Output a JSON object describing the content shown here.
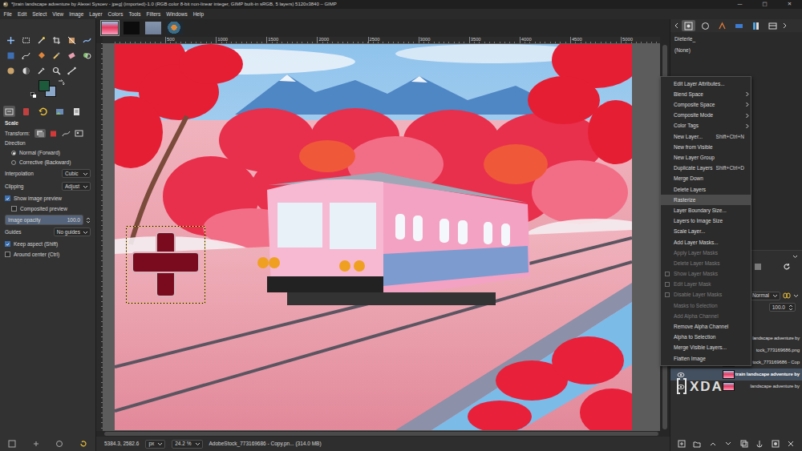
{
  "window": {
    "title": "*[train landscape adventure by Alexei Sysoev - jpeg] (imported)-1.0 (RGB color 8-bit non-linear integer, GIMP built-in sRGB, 5 layers) 5120x3840 – GIMP",
    "controls": [
      "—",
      "□",
      "✕"
    ]
  },
  "menubar": [
    "File",
    "Edit",
    "Select",
    "View",
    "Image",
    "Layer",
    "Colors",
    "Tools",
    "Filters",
    "Windows",
    "Help"
  ],
  "image_tabs": [
    {
      "selected": true
    },
    {
      "selected": false
    },
    {
      "selected": false
    },
    {
      "selected": false
    }
  ],
  "colors": [
    {
      "kind": "foreground",
      "color": "#1d5a3c"
    },
    {
      "kind": "background",
      "color": "#8aa6c8"
    }
  ],
  "tool_options": {
    "tabs": [
      {
        "selected": true
      },
      {
        "selected": false
      },
      {
        "selected": false
      },
      {
        "selected": false
      },
      {
        "selected": false
      }
    ],
    "title": "Scale",
    "transform": {
      "label": "Transform:",
      "options": [
        {
          "selected": true
        },
        {
          "selected": false
        },
        {
          "selected": false
        },
        {
          "selected": false
        }
      ]
    },
    "direction": {
      "label": "Direction",
      "options": [
        {
          "label": "Normal (Forward)",
          "selected": true
        },
        {
          "label": "Corrective (Backward)",
          "selected": false
        }
      ]
    },
    "rows": [
      {
        "kind": "dropdown",
        "label": "Interpolation",
        "value": "Cubic"
      },
      {
        "kind": "dropdown",
        "label": "Clipping",
        "value": "Adjust"
      },
      {
        "kind": "check",
        "label": "Show image preview",
        "checked": true
      },
      {
        "kind": "subcheck",
        "label": "Composited preview",
        "checked": false
      },
      {
        "kind": "slider",
        "label": "Image opacity",
        "value": "100.0",
        "level": 1
      },
      {
        "kind": "dropdown",
        "label": "Guides",
        "value": "No guides"
      },
      {
        "kind": "check",
        "label": "Keep aspect (Shift)",
        "checked": true
      },
      {
        "kind": "check",
        "label": "Around center (Ctrl)",
        "checked": false
      }
    ]
  },
  "ruler": {
    "ticks": [
      "500",
      "1000",
      "1500",
      "2000",
      "2500",
      "3000",
      "3500",
      "4000",
      "4500",
      "5000"
    ]
  },
  "status_bar": {
    "coords": "5384.3, 2582.6",
    "unit": "px",
    "zoom": "24.2 %",
    "info": "AdobeStock_773169686 - Copy.pn... (314.0 MB)"
  },
  "dock": {
    "tabs": [
      {
        "selected": true
      },
      {
        "selected": false
      },
      {
        "selected": false
      },
      {
        "selected": false
      },
      {
        "selected": false
      },
      {
        "selected": false
      }
    ],
    "brush": "Dieterle_",
    "pattern": "(None)",
    "layers": {
      "mode": "Normal",
      "opacity": "100.0",
      "items": [
        {
          "name": "landscape adventure by",
          "visible": true,
          "selected": false
        },
        {
          "name": "tock_773169686.png",
          "visible": true,
          "selected": false
        },
        {
          "name": "tock_773169686 - Cop",
          "visible": true,
          "selected": false
        },
        {
          "name": "train landscape adventure by",
          "visible": true,
          "selected": true
        },
        {
          "name": "landscape adventure by",
          "visible": true,
          "selected": false
        }
      ]
    }
  },
  "context_menu": {
    "items": [
      {
        "label": "Edit Layer Attributes...",
        "kind": "command",
        "disabled": false,
        "selected": false
      },
      {
        "label": "Blend Space",
        "kind": "submenu",
        "disabled": false,
        "selected": false
      },
      {
        "label": "Composite Space",
        "kind": "submenu",
        "disabled": false,
        "selected": false
      },
      {
        "label": "Composite Mode",
        "kind": "submenu",
        "disabled": false,
        "selected": false
      },
      {
        "label": "Color Tags",
        "kind": "submenu",
        "disabled": false,
        "selected": false
      },
      {
        "label": "New Layer...",
        "kind": "command",
        "shortcut": "Shift+Ctrl+N",
        "disabled": false,
        "selected": false
      },
      {
        "label": "New from Visible",
        "kind": "command",
        "disabled": false,
        "selected": false
      },
      {
        "label": "New Layer Group",
        "kind": "command",
        "disabled": false,
        "selected": false
      },
      {
        "label": "Duplicate Layers",
        "kind": "command",
        "shortcut": "Shift+Ctrl+D",
        "disabled": false,
        "selected": false
      },
      {
        "label": "Merge Down",
        "kind": "command",
        "disabled": false,
        "selected": false
      },
      {
        "label": "Delete Layers",
        "kind": "command",
        "disabled": false,
        "selected": false
      },
      {
        "label": "Rasterize",
        "kind": "command",
        "disabled": false,
        "selected": true
      },
      {
        "label": "Layer Boundary Size...",
        "kind": "command",
        "disabled": false,
        "selected": false
      },
      {
        "label": "Layers to Image Size",
        "kind": "command",
        "disabled": false,
        "selected": false
      },
      {
        "label": "Scale Layer...",
        "kind": "command",
        "disabled": false,
        "selected": false
      },
      {
        "label": "Add Layer Masks...",
        "kind": "command",
        "disabled": false,
        "selected": false
      },
      {
        "label": "Apply Layer Masks",
        "kind": "command",
        "disabled": true,
        "selected": false
      },
      {
        "label": "Delete Layer Masks",
        "kind": "command",
        "disabled": true,
        "selected": false
      },
      {
        "label": "Show Layer Masks",
        "kind": "check",
        "checked": false,
        "disabled": true,
        "selected": false
      },
      {
        "label": "Edit Layer Mask",
        "kind": "check",
        "checked": false,
        "disabled": true,
        "selected": false
      },
      {
        "label": "Disable Layer Masks",
        "kind": "check",
        "checked": false,
        "disabled": true,
        "selected": false
      },
      {
        "label": "Masks to Selection",
        "kind": "command",
        "disabled": true,
        "selected": false
      },
      {
        "label": "Add Alpha Channel",
        "kind": "command",
        "disabled": true,
        "selected": false
      },
      {
        "label": "Remove Alpha Channel",
        "kind": "command",
        "disabled": false,
        "selected": false
      },
      {
        "label": "Alpha to Selection",
        "kind": "command",
        "disabled": false,
        "selected": false
      },
      {
        "label": "Merge Visible Layers...",
        "kind": "command",
        "disabled": false,
        "selected": false
      },
      {
        "label": "Flatten Image",
        "kind": "command",
        "disabled": false,
        "selected": false
      }
    ]
  },
  "watermark": "XDA"
}
